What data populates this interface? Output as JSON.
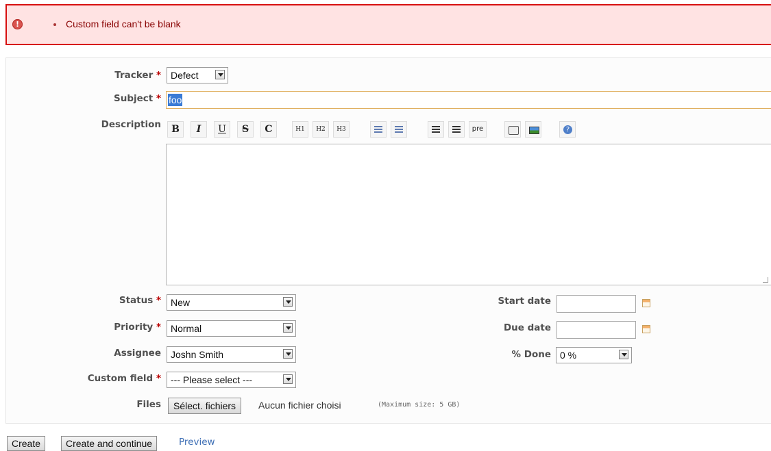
{
  "flash": {
    "icon": "!",
    "messages": [
      "Custom field can't be blank"
    ]
  },
  "form": {
    "tracker": {
      "label": "Tracker",
      "required": "*",
      "value": "Defect"
    },
    "subject": {
      "label": "Subject",
      "required": "*",
      "value": "foo"
    },
    "description": {
      "label": "Description",
      "value": ""
    },
    "toolbar": {
      "buttons": [
        "B",
        "I",
        "U",
        "S",
        "C",
        "H1",
        "H2",
        "H3",
        "pre"
      ]
    },
    "status": {
      "label": "Status",
      "required": "*",
      "value": "New"
    },
    "priority": {
      "label": "Priority",
      "required": "*",
      "value": "Normal"
    },
    "assignee": {
      "label": "Assignee",
      "value": "Joshn Smith"
    },
    "custom_field": {
      "label": "Custom field",
      "required": "*",
      "value": "--- Please select ---"
    },
    "start_date": {
      "label": "Start date",
      "value": ""
    },
    "due_date": {
      "label": "Due date",
      "value": ""
    },
    "done": {
      "label": "% Done",
      "value": "0 %"
    },
    "files": {
      "label": "Files",
      "choose_button": "Sélect. fichiers",
      "status": "Aucun fichier choisi",
      "max_size": "(Maximum size: 5 GB)"
    }
  },
  "actions": {
    "create": "Create",
    "create_continue": "Create and continue",
    "preview": "Preview"
  },
  "colors": {
    "error_bg": "#ffe3e3",
    "error_border": "#d70f0f",
    "focus_border": "#e0b060",
    "link": "#3e6fb5",
    "required": "#bb0000"
  }
}
